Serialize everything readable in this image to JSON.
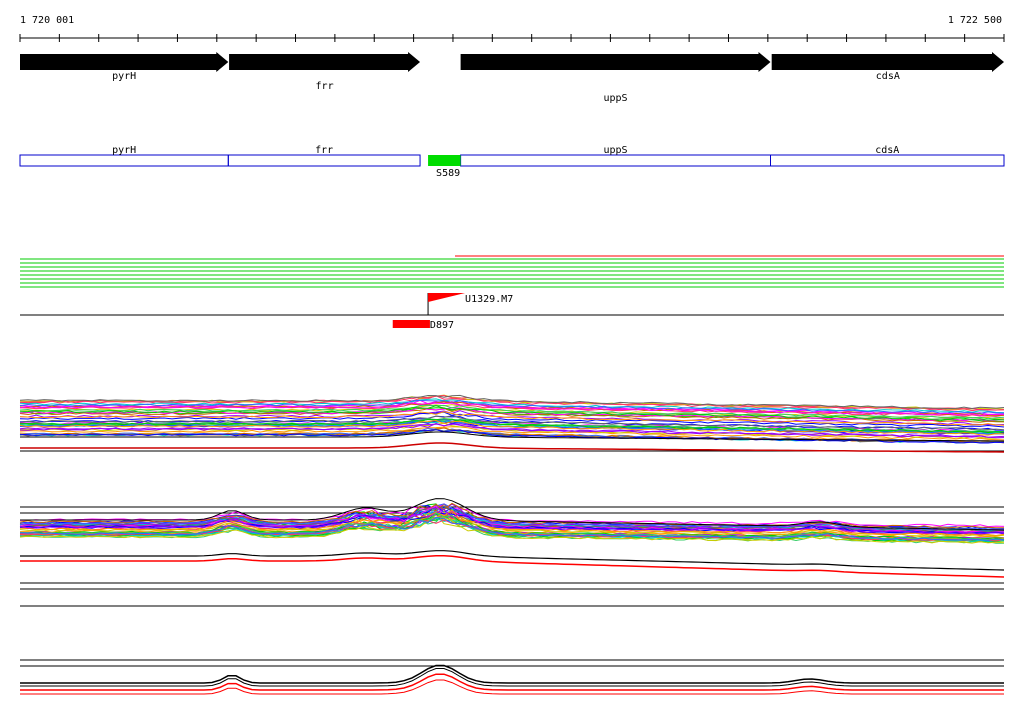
{
  "coords": {
    "start": 1720001,
    "end": 1722500,
    "start_label": "1 720 001",
    "end_label": "1 722 500"
  },
  "genes": [
    {
      "name": "pyrH",
      "start": 1720001,
      "end": 1720530,
      "strand": "+"
    },
    {
      "name": "frr",
      "start": 1720532,
      "end": 1721017,
      "strand": "+"
    },
    {
      "name": "uppS",
      "start": 1721120,
      "end": 1721907,
      "strand": "+"
    },
    {
      "name": "cdsA",
      "start": 1721910,
      "end": 1722500,
      "strand": "+"
    }
  ],
  "segments": [
    {
      "name": "pyrH",
      "start": 1720001,
      "end": 1720530
    },
    {
      "name": "frr",
      "start": 1720530,
      "end": 1721017
    },
    {
      "name": "uppS",
      "start": 1721120,
      "end": 1721907
    },
    {
      "name": "cdsA",
      "start": 1721907,
      "end": 1722500
    }
  ],
  "feature": {
    "name": "S589",
    "start": 1721017,
    "end": 1721120,
    "color": "#00dd00"
  },
  "tss": {
    "name": "U1329.M7",
    "position": 1721017,
    "color": "#ff0000"
  },
  "antisense": {
    "name": "D897",
    "start": 1720940,
    "end": 1721037,
    "color": "#ff0000"
  },
  "colors": {
    "gene_arrow": "#000000",
    "segment_outline": "#0000cc",
    "green_track": "#00cc00",
    "red_track": "#ff0000"
  }
}
